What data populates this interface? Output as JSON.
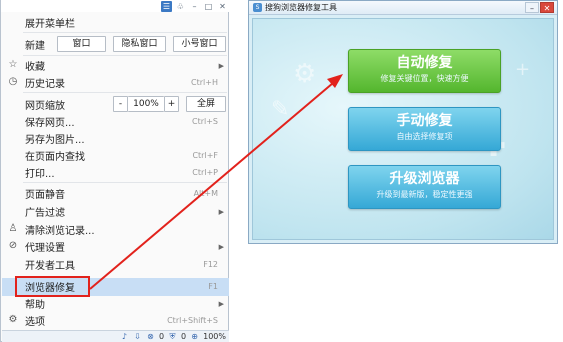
{
  "menu": {
    "expand_menubar": "展开菜单栏",
    "new_label": "新建",
    "new_window": "窗口",
    "incognito_window": "隐私窗口",
    "small_window": "小号窗口",
    "favorites": "收藏",
    "history": "历史记录",
    "history_shortcut": "Ctrl+H",
    "zoom_label": "网页缩放",
    "zoom_minus": "-",
    "zoom_value": "100%",
    "zoom_plus": "+",
    "fullscreen": "全屏",
    "save_page": "保存网页...",
    "save_page_shortcut": "Ctrl+S",
    "save_as_image": "另存为图片...",
    "find_in_page": "在页面内查找",
    "find_shortcut": "Ctrl+F",
    "print": "打印...",
    "print_shortcut": "Ctrl+P",
    "mute_page": "页面静音",
    "mute_shortcut": "Alt+M",
    "ad_filter": "广告过滤",
    "clear_history": "清除浏览记录...",
    "proxy_settings": "代理设置",
    "dev_tools": "开发者工具",
    "dev_tools_shortcut": "F12",
    "browser_repair": "浏览器修复",
    "browser_repair_shortcut": "F1",
    "help": "帮助",
    "options": "选项",
    "options_shortcut": "Ctrl+Shift+S"
  },
  "statusbar": {
    "blocked_count": "0",
    "shield_count": "0",
    "zoom": "100%"
  },
  "tool": {
    "title": "搜狗浏览器修复工具",
    "auto_repair_title": "自动修复",
    "auto_repair_sub": "修复关键位置，快速方便",
    "manual_repair_title": "手动修复",
    "manual_repair_sub": "自由选择修复项",
    "upgrade_title": "升级浏览器",
    "upgrade_sub": "升级到最新版，稳定性更强"
  },
  "colors": {
    "highlight": "#c8def5",
    "annotation_red": "#e2221c",
    "auto_green": "#54b62e",
    "blue_button": "#35a8d6"
  }
}
